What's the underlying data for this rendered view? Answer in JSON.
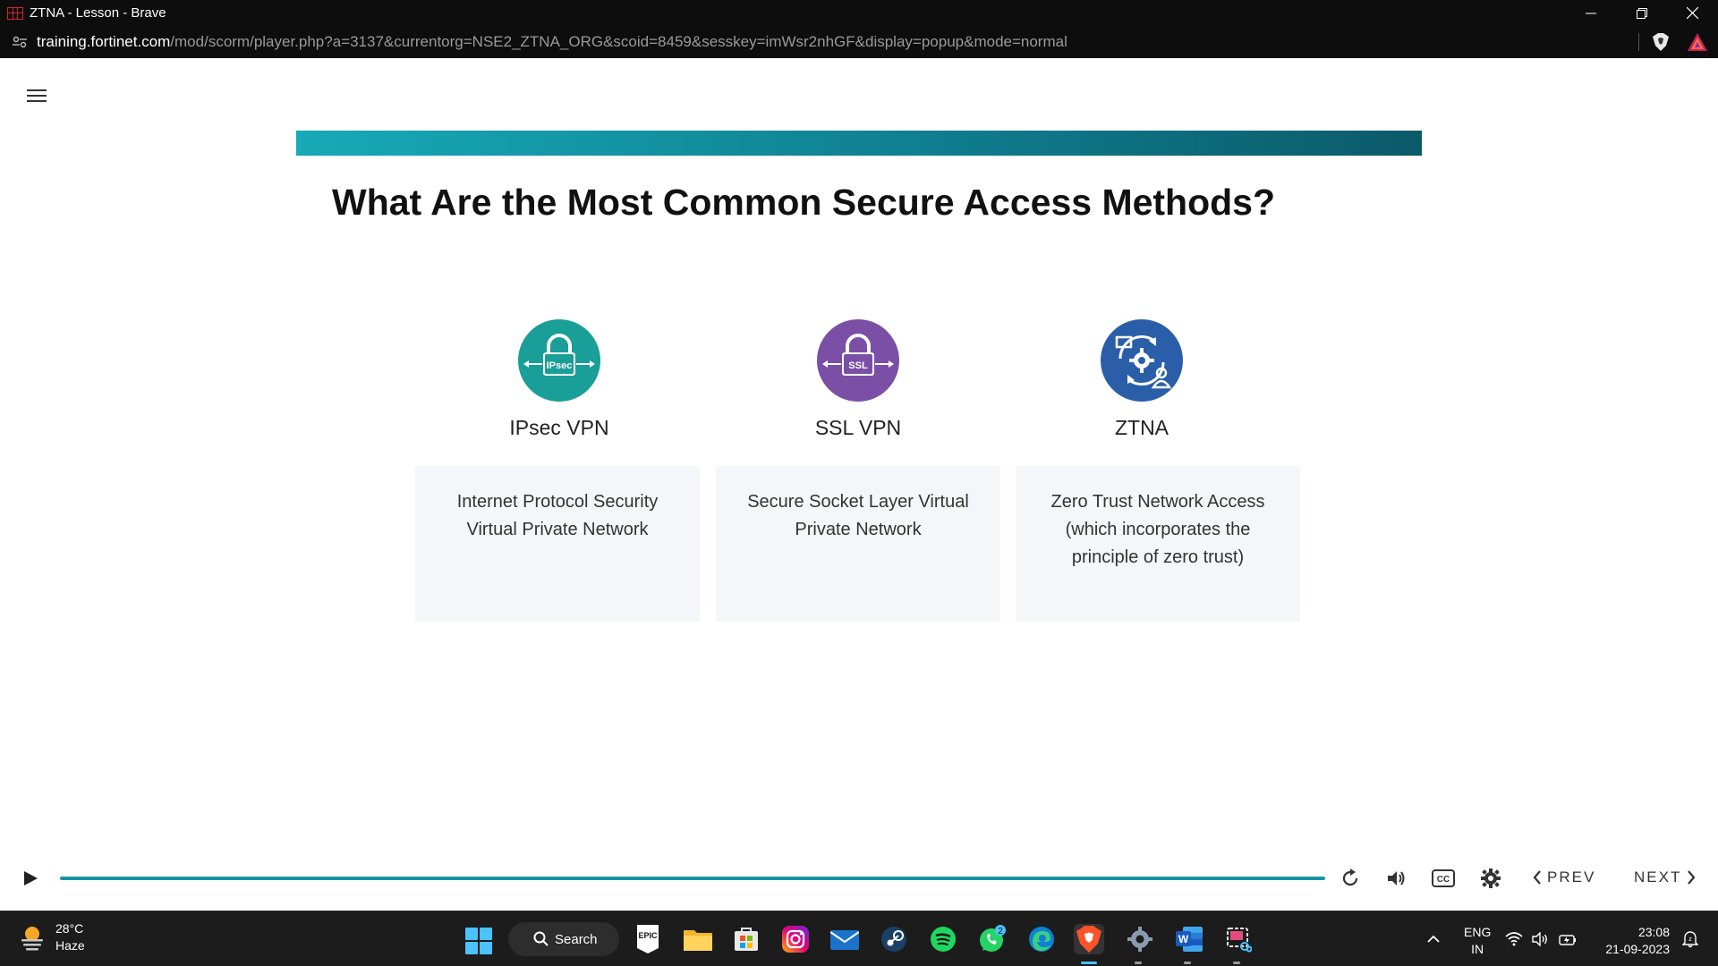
{
  "window": {
    "title": "ZTNA - Lesson - Brave",
    "url_host": "training.fortinet.com",
    "url_path": "/mod/scorm/player.php?a=3137&currentorg=NSE2_ZTNA_ORG&scoid=8459&sesskey=imWsr2nhGF&display=popup&mode=normal"
  },
  "slide": {
    "title": "What Are the Most Common Secure Access Methods?",
    "accent_color": "#17aab7",
    "methods": [
      {
        "label": "IPsec VPN",
        "badge": "IPsec",
        "color": "#1a9e98",
        "icon": "padlock-arrows-icon",
        "description_lines": [
          "Internet Protocol Security",
          "Virtual Private Network"
        ]
      },
      {
        "label": "SSL VPN",
        "badge": "SSL",
        "color": "#7a4fa5",
        "icon": "padlock-ssl-icon",
        "description_lines": [
          "Secure Socket Layer Virtual",
          "Private Network"
        ]
      },
      {
        "label": "ZTNA",
        "badge": "",
        "color": "#2a5ea8",
        "icon": "gear-device-user-icon",
        "description_lines": [
          "Zero Trust Network Access",
          "(which incorporates the",
          "principle of zero trust)"
        ]
      }
    ]
  },
  "player": {
    "prev_label": "PREV",
    "next_label": "NEXT",
    "progress": 1.0,
    "icons": [
      "play-icon",
      "replay-icon",
      "volume-icon",
      "captions-icon",
      "settings-icon"
    ]
  },
  "taskbar": {
    "weather_temp": "28°C",
    "weather_desc": "Haze",
    "search_label": "Search",
    "lang_line1": "ENG",
    "lang_line2": "IN",
    "time": "23:08",
    "date": "21-09-2023",
    "whatsapp_badge": "2",
    "epic_label": "EPIC",
    "pinned_apps": [
      "epic-games",
      "file-explorer",
      "microsoft-store",
      "instagram",
      "mail",
      "steam",
      "spotify",
      "whatsapp",
      "edge",
      "brave",
      "settings",
      "word",
      "snipping-tool"
    ]
  }
}
